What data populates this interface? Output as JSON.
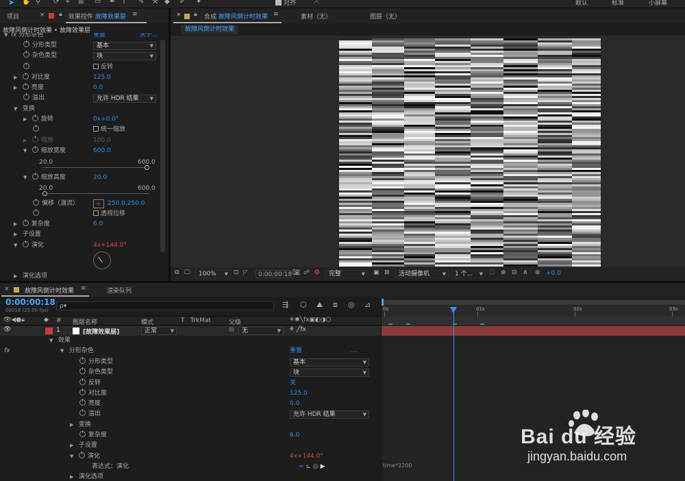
{
  "toolbar": {
    "snap_label": "对齐",
    "workspaces": [
      "默认",
      "标准",
      "小屏幕"
    ]
  },
  "left_panel": {
    "tabs": {
      "project": "项目",
      "effects": "效果控件",
      "effects_layer": "故障效果层"
    },
    "breadcrumb": "故障风倒计时效果 • 故障效果层",
    "header": {
      "label": "分形杂色",
      "reset": "重置",
      "about": "关于..."
    },
    "props": {
      "fractal_type": {
        "label": "分形类型",
        "value": "基本"
      },
      "noise_type": {
        "label": "杂色类型",
        "value": "块"
      },
      "invert": {
        "label": "反转"
      },
      "contrast": {
        "label": "对比度",
        "value": "125.0"
      },
      "brightness": {
        "label": "亮度",
        "value": "0.0"
      },
      "overflow": {
        "label": "溢出",
        "value": "允许 HDR 结果"
      },
      "transform": {
        "label": "变换"
      },
      "rotation": {
        "label": "旋转",
        "value_a": "0x",
        "value_b": "+0.0°"
      },
      "uniform_scale": {
        "label": "统一缩放"
      },
      "scale": {
        "label": "缩放",
        "value": "100.0"
      },
      "scale_width": {
        "label": "缩放宽度",
        "value": "600.0",
        "min": "20.0",
        "max": "600.0",
        "level": 1.0
      },
      "scale_height": {
        "label": "缩放高度",
        "value": "20.0",
        "min": "20.0",
        "max": "600.0",
        "level": 0.0
      },
      "offset": {
        "label": "偏移（湍流）",
        "value": "250.0,250.0"
      },
      "perspective": {
        "label": "透视位移"
      },
      "complexity": {
        "label": "复杂度",
        "value": "6.0"
      },
      "sub_settings": {
        "label": "子设置"
      },
      "evolution": {
        "label": "演化",
        "value_a": "4x",
        "value_b": "+144.0°"
      },
      "evolution_options": {
        "label": "演化选项"
      }
    }
  },
  "comp_panel": {
    "tabs": {
      "comp_prefix": "合成",
      "comp_name": "故障风倒计时效果",
      "footage": "素材（无）",
      "layer": "图层（无）"
    },
    "comp_tag": "故障风倒计时效果",
    "bottom": {
      "zoom": "100%",
      "timecode": "0:00:00:18",
      "quality": "完整",
      "camera": "活动摄像机",
      "views": "1 个...",
      "exposure": "+0.0"
    }
  },
  "timeline": {
    "tabs": {
      "comp": "故障风倒计时效果",
      "render": "渲染队列"
    },
    "timecode": "0:00:00:18",
    "fps": "00018 (25.00 fps)",
    "search_placeholder": "ρ▾",
    "cols": {
      "layer_name": "图层名称",
      "mode": "模式",
      "t": "T",
      "trkmat": "TrkMat",
      "parent": "父级"
    },
    "layer": {
      "num": "1",
      "name": "[故障效果层]",
      "mode": "正常",
      "parent": "无"
    },
    "rows": {
      "effects": "效果",
      "fractal": "分形杂色",
      "reset": "重置",
      "dots": "....",
      "fractal_type": {
        "label": "分形类型",
        "value": "基本"
      },
      "noise_type": {
        "label": "杂色类型",
        "value": "块"
      },
      "invert": {
        "label": "反转",
        "value": "关"
      },
      "contrast": {
        "label": "对比度",
        "value": "125.0"
      },
      "brightness": {
        "label": "亮度",
        "value": "0.0"
      },
      "overflow": {
        "label": "溢出",
        "value": "允许 HDR 结果"
      },
      "transform": "变换",
      "complexity": {
        "label": "复杂度",
        "value": "6.0"
      },
      "sub_settings": "子设置",
      "evolution": {
        "label": "演化",
        "value_a": "4x",
        "value_b": "+144.0°"
      },
      "expression": {
        "label": "表达式：演化",
        "code": "time*2200"
      },
      "evolution_options": "演化选项"
    },
    "ruler": {
      "labels": [
        "0s",
        "01s",
        "02s",
        "03s"
      ]
    }
  },
  "watermark": {
    "brand": "Bai du 经验",
    "url": "jingyan.baidu.com"
  }
}
